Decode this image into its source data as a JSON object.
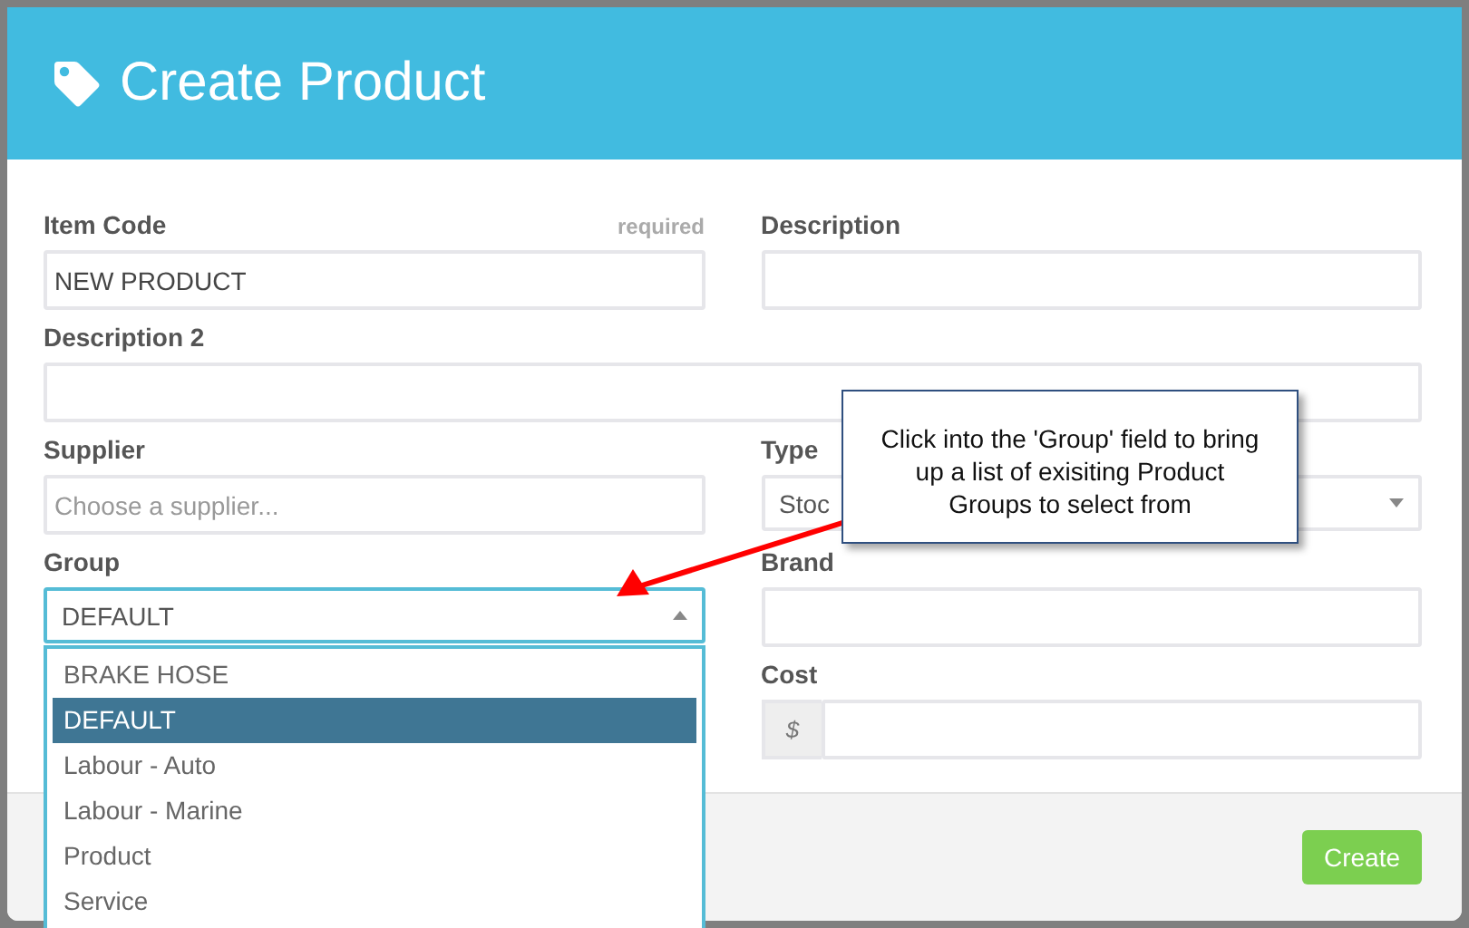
{
  "modal": {
    "title": "Create Product",
    "fields": [
      {
        "kind": "text",
        "label": "Item Code",
        "note": "required",
        "value": "NEW PRODUCT"
      },
      {
        "kind": "text",
        "label": "Description"
      },
      {
        "kind": "text",
        "label": "Description 2",
        "wide": true
      },
      {
        "kind": "text",
        "label": "Supplier",
        "placeholder": "Choose a supplier..."
      },
      {
        "kind": "select",
        "label": "Type",
        "value": "Stoc",
        "expanded": false
      },
      {
        "kind": "select",
        "label": "Group",
        "value": "DEFAULT",
        "expanded": true,
        "focused": true,
        "options": [
          {
            "label": "BRAKE HOSE",
            "selected": false
          },
          {
            "label": "DEFAULT",
            "selected": true
          },
          {
            "label": "Labour - Auto",
            "selected": false
          },
          {
            "label": "Labour - Marine",
            "selected": false
          },
          {
            "label": "Product",
            "selected": false
          },
          {
            "label": "Service",
            "selected": false
          }
        ]
      },
      {
        "kind": "text",
        "label": "Brand"
      },
      {
        "kind": "currency",
        "label": "Cost",
        "prefix": "$"
      }
    ],
    "buttons": [
      {
        "label": "Create"
      }
    ]
  },
  "callout": {
    "text": "Click into the 'Group' field to bring up a list of exisiting Product Groups to select from"
  }
}
